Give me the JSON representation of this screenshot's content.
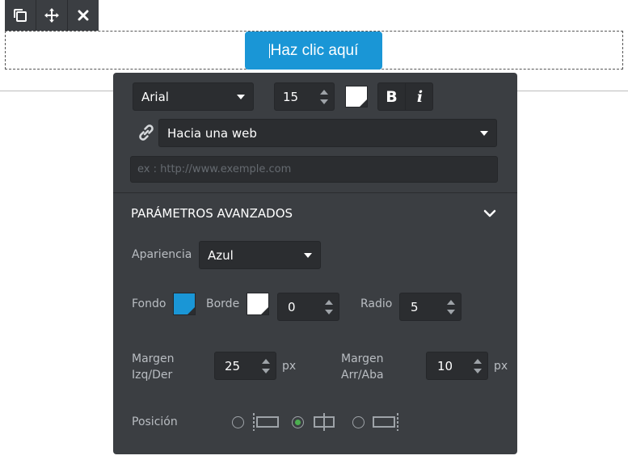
{
  "toolbar": {
    "icons": [
      "duplicate-icon",
      "move-icon",
      "close-icon"
    ]
  },
  "button_label": "Haz clic aquí",
  "font": {
    "family": "Arial",
    "size": "15",
    "bold_label": "B",
    "italic_label": "i"
  },
  "link": {
    "type": "Hacia una web",
    "url_placeholder": "ex : http://www.exemple.com"
  },
  "advanced": {
    "title": "PARÁMETROS AVANZADOS",
    "appearance_label": "Apariencia",
    "appearance_value": "Azul",
    "background_label": "Fondo",
    "background_color": "#1a96d6",
    "border_label": "Borde",
    "border_color": "#ffffff",
    "border_value": "0",
    "radius_label": "Radio",
    "radius_value": "5",
    "margin_lr_label_1": "Margen",
    "margin_lr_label_2": "Izq/Der",
    "margin_lr_value": "25",
    "margin_tb_label_1": "Margen",
    "margin_tb_label_2": "Arr/Aba",
    "margin_tb_value": "10",
    "unit": "px",
    "position_label": "Posición",
    "position_selected": "center"
  },
  "colors": {
    "panel": "#3b3e42",
    "accent": "#1a96d6",
    "radio_on": "#4caf50"
  }
}
